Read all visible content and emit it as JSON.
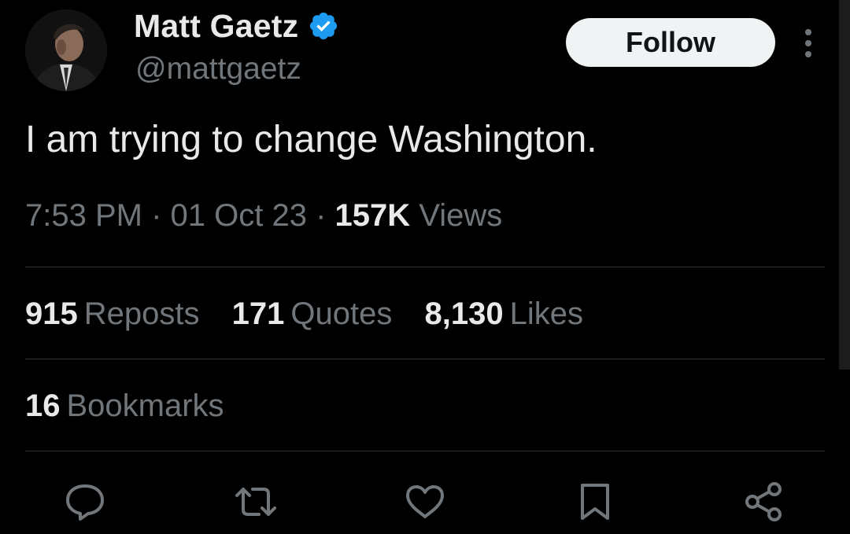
{
  "author": {
    "display_name": "Matt Gaetz",
    "handle": "@mattgaetz",
    "verified_icon": "verified-badge-icon",
    "avatar_icon": "avatar-photo"
  },
  "header": {
    "follow_label": "Follow",
    "more_icon": "more-vertical-icon"
  },
  "tweet": {
    "text": "I am trying to change Washington."
  },
  "meta": {
    "time": "7:53 PM",
    "sep1": " · ",
    "date": "01 Oct 23",
    "sep2": " · ",
    "views_count": "157K",
    "views_label": " Views"
  },
  "stats": {
    "reposts_count": "915",
    "reposts_label": "Reposts",
    "quotes_count": "171",
    "quotes_label": "Quotes",
    "likes_count": "8,130",
    "likes_label": "Likes",
    "bookmarks_count": "16",
    "bookmarks_label": "Bookmarks"
  },
  "actions": [
    {
      "icon": "reply-icon"
    },
    {
      "icon": "repost-icon"
    },
    {
      "icon": "like-icon"
    },
    {
      "icon": "bookmark-icon"
    },
    {
      "icon": "share-icon"
    }
  ],
  "colors": {
    "background": "#000000",
    "primary_text": "#e7e9ea",
    "secondary_text": "#71767b",
    "divider": "#2f3336",
    "verified_blue": "#1d9bf0",
    "follow_bg": "#eff3f4"
  }
}
